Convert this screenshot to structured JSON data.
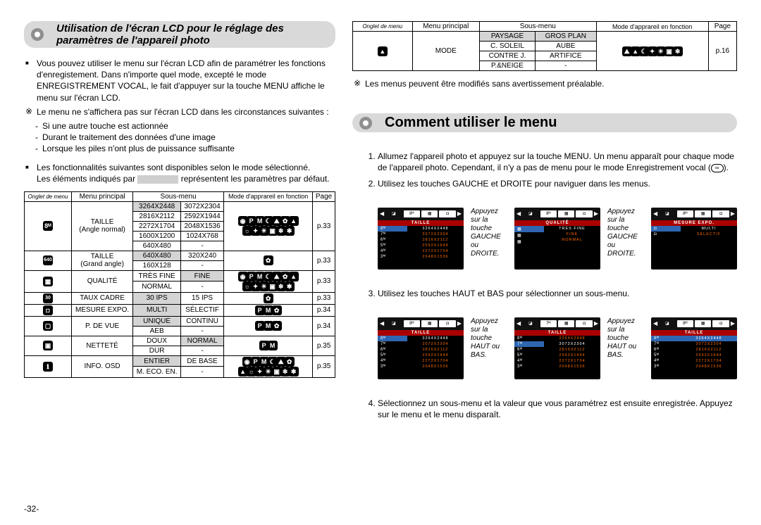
{
  "page_number": "-32-",
  "title_main": "Utilisation de l'écran LCD pour le réglage des paramètres de l'appareil photo",
  "intro_para": "Vous pouvez utiliser le menu sur l'écran LCD afin de paramétrer les fonctions d'enregistement. Dans n'importe quel mode, excepté le mode ENREGISTREMENT VOCAL, le fait d'appuyer sur la touche MENU affiche le menu sur l'écran LCD.",
  "note_para": "Le menu ne s'affichera pas sur l'écran LCD dans les circonstances suivantes :",
  "note_items": [
    "Si une autre touche est actionnée",
    "Durant le traitement des données d'une image",
    "Lorsque les piles n'ont plus de puissance suffisante"
  ],
  "features_intro_a": "Les fonctionnalités suivantes sont disponibles selon le mode sélectionné.",
  "features_intro_b_pre": "Les éléments indiqués par ",
  "features_intro_b_post": " représentent les paramètres par défaut.",
  "table_headers": {
    "onglet": "Onglet de menu",
    "principal": "Menu principal",
    "sous": "Sous-menu",
    "mode": "Mode d'apprareil en fonction",
    "page": "Page"
  },
  "table1": {
    "r1": {
      "principal_a": "TAILLE",
      "principal_b": "(Angle normal)",
      "subs": [
        "3264X2448",
        "3072X2304",
        "2816X2112",
        "2592X1944",
        "2272X1704",
        "2048X1536",
        "1600X1200",
        "1024X768",
        "640X480",
        "-"
      ],
      "page": "p.33"
    },
    "r2": {
      "principal_a": "TAILLE",
      "principal_b": "(Grand angle)",
      "subs": [
        "640X480",
        "320X240",
        "160X128",
        "-"
      ],
      "page": "p.33"
    },
    "r3": {
      "principal": "QUALITÉ",
      "subs": [
        "TRÈS FINE",
        "FINE",
        "NORMAL",
        "-"
      ],
      "page": "p.33"
    },
    "r4": {
      "principal": "TAUX CADRE",
      "subs": [
        "30 IPS",
        "15 IPS"
      ],
      "page": "p.33"
    },
    "r5": {
      "principal": "MESURE EXPO.",
      "subs": [
        "MULTI",
        "SÉLECTIF"
      ],
      "page": "p.34"
    },
    "r6": {
      "principal": "P. DE VUE",
      "subs": [
        "UNIQUE",
        "CONTINU",
        "AEB",
        "-"
      ],
      "page": "p.34"
    },
    "r7": {
      "principal": "NETTETÉ",
      "subs": [
        "DOUX",
        "NORMAL",
        "DUR",
        "-"
      ],
      "page": "p.35"
    },
    "r8": {
      "principal": "INFO. OSD",
      "subs": [
        "ENTIER",
        "DE BASE",
        "M. ECO. EN.",
        "-"
      ],
      "page": "p.35"
    }
  },
  "table2": {
    "principal": "MODE",
    "subs": [
      "PAYSAGE",
      "GROS PLAN",
      "C. SOLEIL",
      "AUBE",
      "CONTRE J.",
      "ARTIFICE",
      "P.&NEIGE",
      "-"
    ],
    "page": "p.16"
  },
  "note_right": "Les menus peuvent être modifiés sans avertissement préalable.",
  "section_title": "Comment utiliser le menu",
  "steps": {
    "s1_a": "Allumez l'appareil photo et appuyez sur la touche MENU. Un menu apparaît pour chaque mode de l'appareil photo. Cependant, il n'y a pas de menu pour le mode Enregistrement vocal (",
    "s1_b": ").",
    "s2": "Utilisez les touches GAUCHE et DROITE pour naviguer dans les menus.",
    "s3": "Utilisez les touches HAUT et BAS pour sélectionner un sous-menu.",
    "s4": "Sélectionnez un sous-menu et la valeur que vous paramétrez est ensuite enregistrée. Appuyez sur le menu et le menu disparaît."
  },
  "lcd_notes": {
    "gauche": "Appuyez sur la touche GAUCHE ou DROITE.",
    "haut": "Appuyez sur la touche HAUT ou BAS."
  },
  "lcd_titles": {
    "taille": "TAILLE",
    "qualite": "QUALITÉ",
    "mesure": "MESURE EXPO."
  },
  "lcd_sizes": {
    "a": "3264X2448",
    "b": "3072X2304",
    "c": "2816X2112",
    "d": "2592X1944",
    "e": "2272X1704",
    "f": "2048X1536"
  },
  "lcd_left_labels": {
    "a": "8ᴹ",
    "b": "7ᴹ",
    "c": "6ᴹ",
    "d": "5ᴹ",
    "e": "4ᴹ",
    "f": "3ᴹ"
  },
  "lcd_qual": {
    "a": "TRÈS FINE",
    "b": "FINE",
    "c": "NORMAL"
  },
  "lcd_mes": {
    "a": "MULTI",
    "b": "SÉLECTIF"
  },
  "icons": {
    "m8": "8ᴹ",
    "m640": "640",
    "grid": "▦",
    "m30": "30",
    "dot": "◘",
    "sq": "▢",
    "play": "▣",
    "osd": "ℹ",
    "mount": "▲"
  }
}
